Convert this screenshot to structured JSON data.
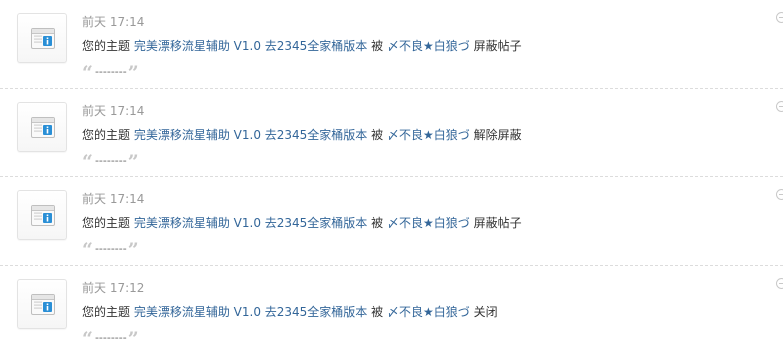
{
  "notices": [
    {
      "time": "前天 17:14",
      "prefix": "您的主题",
      "thread_title": "完美漂移流星辅助 V1.0 去2345全家桶版本",
      "by": "被",
      "user": "〆不良★白狼づ",
      "action": "屏蔽帖子",
      "quote_open": "“",
      "quote": "--------",
      "quote_close": "”"
    },
    {
      "time": "前天 17:14",
      "prefix": "您的主题",
      "thread_title": "完美漂移流星辅助 V1.0 去2345全家桶版本",
      "by": "被",
      "user": "〆不良★白狼づ",
      "action": "解除屏蔽",
      "quote_open": "“",
      "quote": "--------",
      "quote_close": "”"
    },
    {
      "time": "前天 17:14",
      "prefix": "您的主题",
      "thread_title": "完美漂移流星辅助 V1.0 去2345全家桶版本",
      "by": "被",
      "user": "〆不良★白狼づ",
      "action": "屏蔽帖子",
      "quote_open": "“",
      "quote": "--------",
      "quote_close": "”"
    },
    {
      "time": "前天 17:12",
      "prefix": "您的主题",
      "thread_title": "完美漂移流星辅助 V1.0 去2345全家桶版本",
      "by": "被",
      "user": "〆不良★白狼づ",
      "action": "关闭",
      "quote_open": "“",
      "quote": "--------",
      "quote_close": "”"
    }
  ],
  "icons": {
    "avatar": "system-notice-icon",
    "delete": "delete-notice-icon"
  },
  "colors": {
    "link": "#336699",
    "time": "#999999",
    "text": "#333333",
    "notice_icon_blue": "#2a8fd6"
  }
}
